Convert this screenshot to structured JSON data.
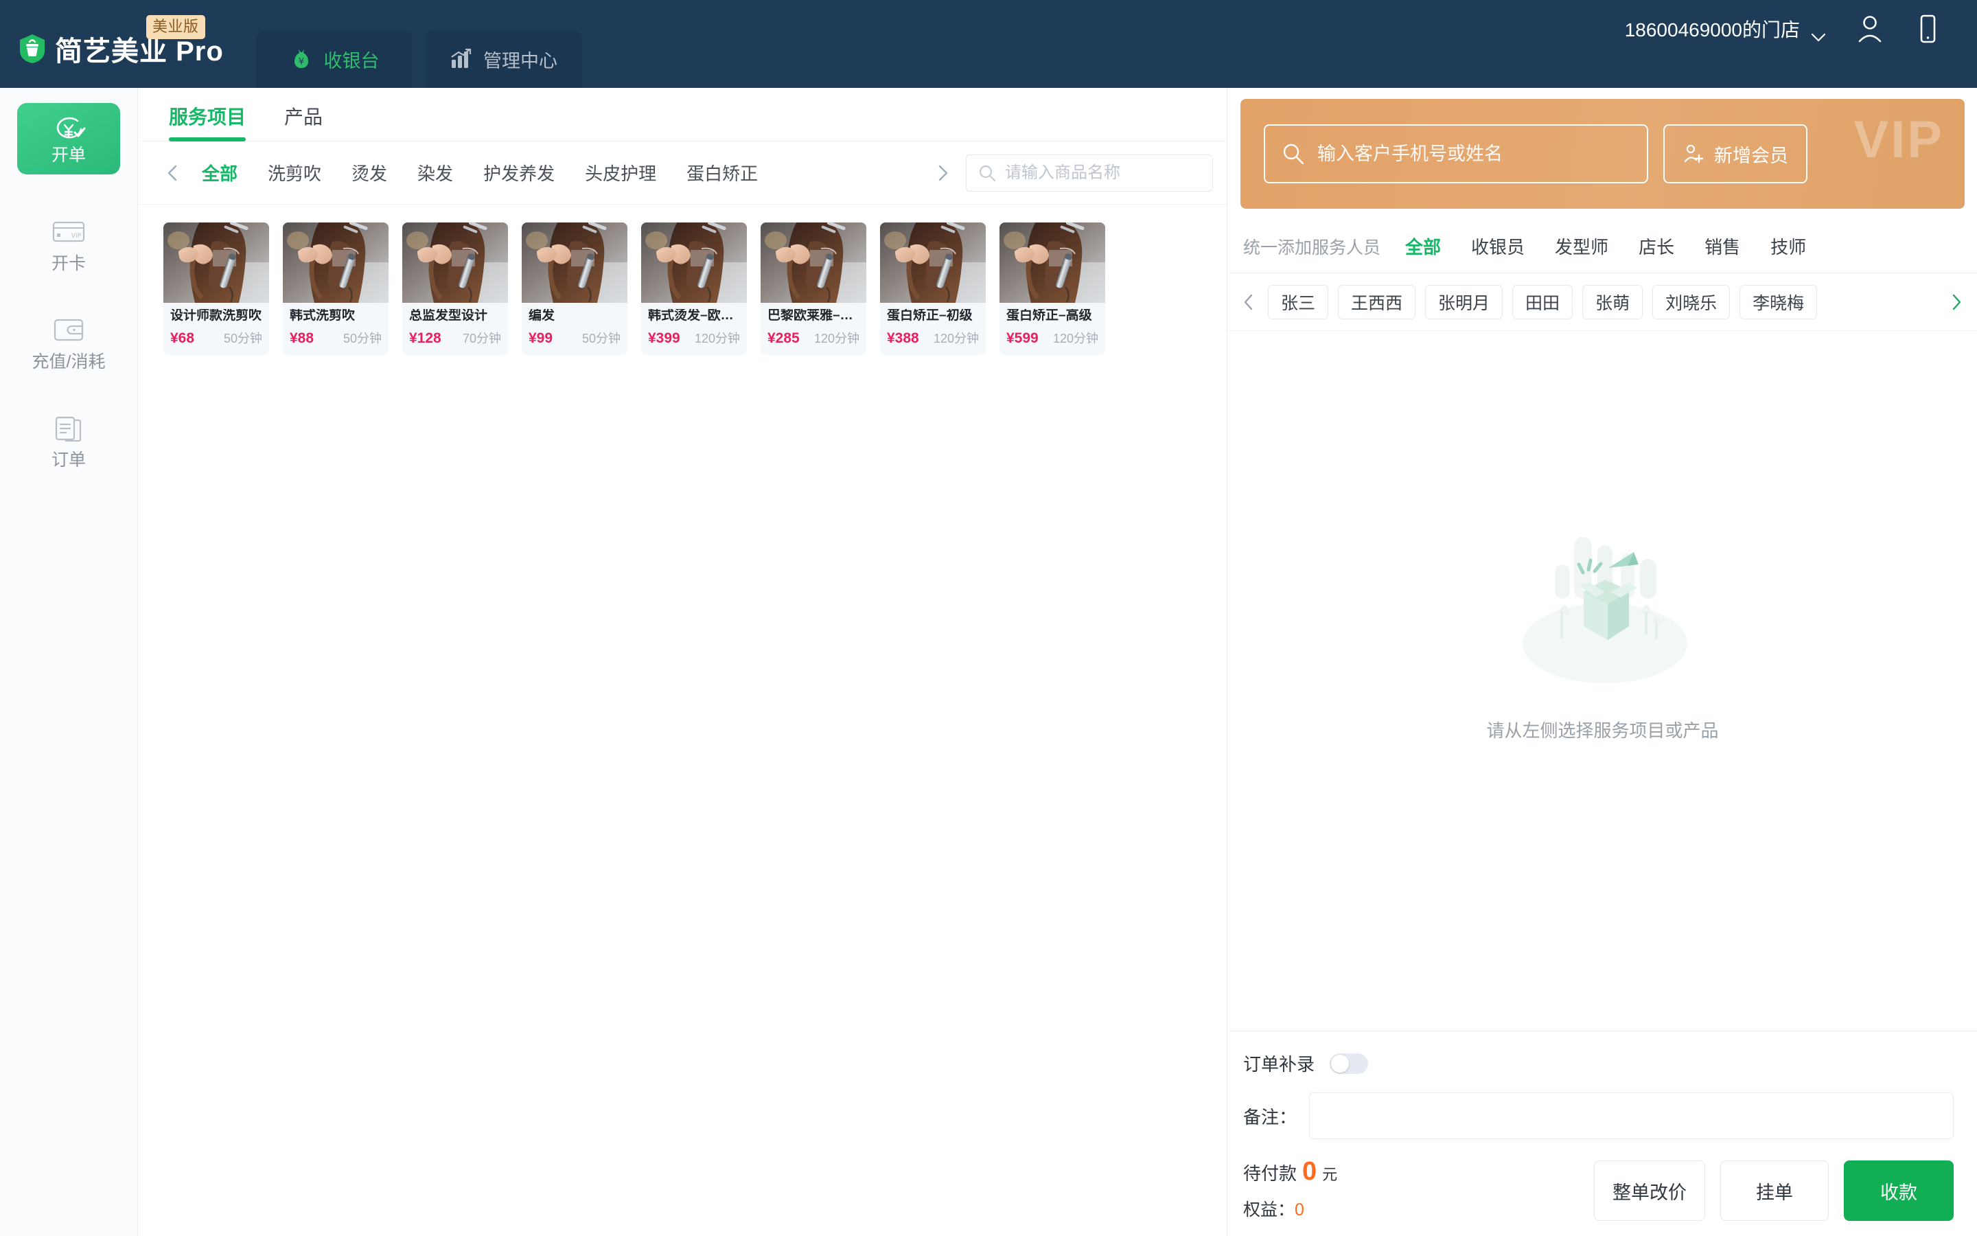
{
  "header": {
    "brand_name": "简艺美业 Pro",
    "brand_badge": "美业版",
    "nav": [
      {
        "label": "收银台",
        "icon": "money-bag-icon",
        "active": true
      },
      {
        "label": "管理中心",
        "icon": "bar-chart-icon",
        "active": false
      }
    ],
    "store_name": "18600469000的门店",
    "user_icon": "user-icon",
    "mobile_icon": "mobile-phone-icon"
  },
  "sidebar": {
    "items": [
      {
        "label": "开单",
        "icon": "yuan-check-icon",
        "active": true
      },
      {
        "label": "开卡",
        "icon": "vip-card-icon",
        "active": false
      },
      {
        "label": "充值/消耗",
        "icon": "wallet-icon",
        "active": false
      },
      {
        "label": "订单",
        "icon": "order-clipboard-icon",
        "active": false
      }
    ]
  },
  "content": {
    "tabs": [
      {
        "label": "服务项目",
        "active": true
      },
      {
        "label": "产品",
        "active": false
      }
    ],
    "categories": [
      {
        "label": "全部",
        "active": true
      },
      {
        "label": "洗剪吹",
        "active": false
      },
      {
        "label": "烫发",
        "active": false
      },
      {
        "label": "染发",
        "active": false
      },
      {
        "label": "护发养发",
        "active": false
      },
      {
        "label": "头皮护理",
        "active": false
      },
      {
        "label": "蛋白矫正",
        "active": false
      }
    ],
    "search": {
      "value": "",
      "placeholder": "请输入商品名称",
      "icon": "search-icon"
    },
    "prev_arrow": "chevron-left-icon",
    "next_arrow": "chevron-right-icon",
    "products": [
      {
        "name": "设计师款洗剪吹",
        "price": "¥68",
        "duration": "50分钟"
      },
      {
        "name": "韩式洗剪吹",
        "price": "¥88",
        "duration": "50分钟"
      },
      {
        "name": "总监发型设计",
        "price": "¥128",
        "duration": "70分钟"
      },
      {
        "name": "编发",
        "price": "¥99",
        "duration": "50分钟"
      },
      {
        "name": "韩式烫发–欧莱雅",
        "price": "¥399",
        "duration": "120分钟"
      },
      {
        "name": "巴黎欧莱雅–染发",
        "price": "¥285",
        "duration": "120分钟"
      },
      {
        "name": "蛋白矫正–初级",
        "price": "¥388",
        "duration": "120分钟"
      },
      {
        "name": "蛋白矫正–高级",
        "price": "¥599",
        "duration": "120分钟"
      }
    ]
  },
  "right": {
    "vip": {
      "watermark": "VIP",
      "search": {
        "value": "",
        "placeholder": "输入客户手机号或姓名",
        "icon": "search-icon"
      },
      "add_member_label": "新增会员",
      "add_member_icon": "add-user-icon"
    },
    "staff": {
      "lead_label": "统一添加服务人员",
      "roles": [
        {
          "label": "全部",
          "active": true
        },
        {
          "label": "收银员",
          "active": false
        },
        {
          "label": "发型师",
          "active": false
        },
        {
          "label": "店长",
          "active": false
        },
        {
          "label": "销售",
          "active": false
        },
        {
          "label": "技师",
          "active": false
        }
      ],
      "prev_arrow": "chevron-left-icon",
      "next_arrow": "chevron-right-icon",
      "people": [
        "张三",
        "王西西",
        "张明月",
        "田田",
        "张萌",
        "刘晓乐",
        "李晓梅"
      ]
    },
    "empty": {
      "image": "empty-box-illustration",
      "text": "请从左侧选择服务项目或产品"
    },
    "order": {
      "supplement_label": "订单补录",
      "supplement_on": false,
      "note_label": "备注：",
      "note_value": "",
      "due_label": "待付款",
      "due_amount": "0",
      "due_unit": "元",
      "benefit_label": "权益：",
      "benefit_value": "0",
      "buttons": [
        {
          "label": "整单改价",
          "kind": "default"
        },
        {
          "label": "挂单",
          "kind": "default"
        },
        {
          "label": "收款",
          "kind": "primary"
        }
      ]
    }
  },
  "colors": {
    "header_bg": "#1e3c57",
    "brand_green": "#2ebd6b",
    "accent_green": "#14b866",
    "price_pink": "#ec1f5e",
    "vip_orange": "#e2a268",
    "amount_orange": "#ff6a1e",
    "badge_bg": "#f6ddb5"
  }
}
